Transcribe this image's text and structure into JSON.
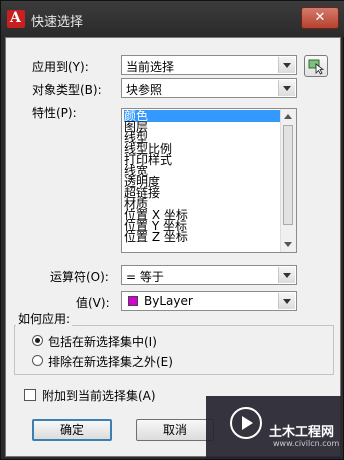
{
  "window": {
    "title": "快速选择",
    "close_label": "✕"
  },
  "apply_to": {
    "label": "应用到(Y):",
    "value": "当前选择"
  },
  "object_type": {
    "label": "对象类型(B):",
    "value": "块参照"
  },
  "properties": {
    "label": "特性(P):",
    "items": [
      "颜色",
      "图层",
      "线型",
      "线型比例",
      "打印样式",
      "线宽",
      "透明度",
      "超链接",
      "材质",
      "位置 X 坐标",
      "位置 Y 坐标",
      "位置 Z 坐标"
    ],
    "selected_index": 0
  },
  "operator": {
    "label": "运算符(O):",
    "value": "= 等于"
  },
  "value_field": {
    "label": "值(V):",
    "value": "ByLayer",
    "swatch_color": "#d400d4"
  },
  "how_to_apply": {
    "label": "如何应用:",
    "include": "包括在新选择集中(I)",
    "exclude": "排除在新选择集之外(E)",
    "selected": "include"
  },
  "append": {
    "label": "附加到当前选择集(A)",
    "checked": false
  },
  "buttons": {
    "ok": "确定",
    "cancel": "取消"
  },
  "watermark": {
    "text": "土木工程网",
    "url": "www.civilcn.com"
  }
}
